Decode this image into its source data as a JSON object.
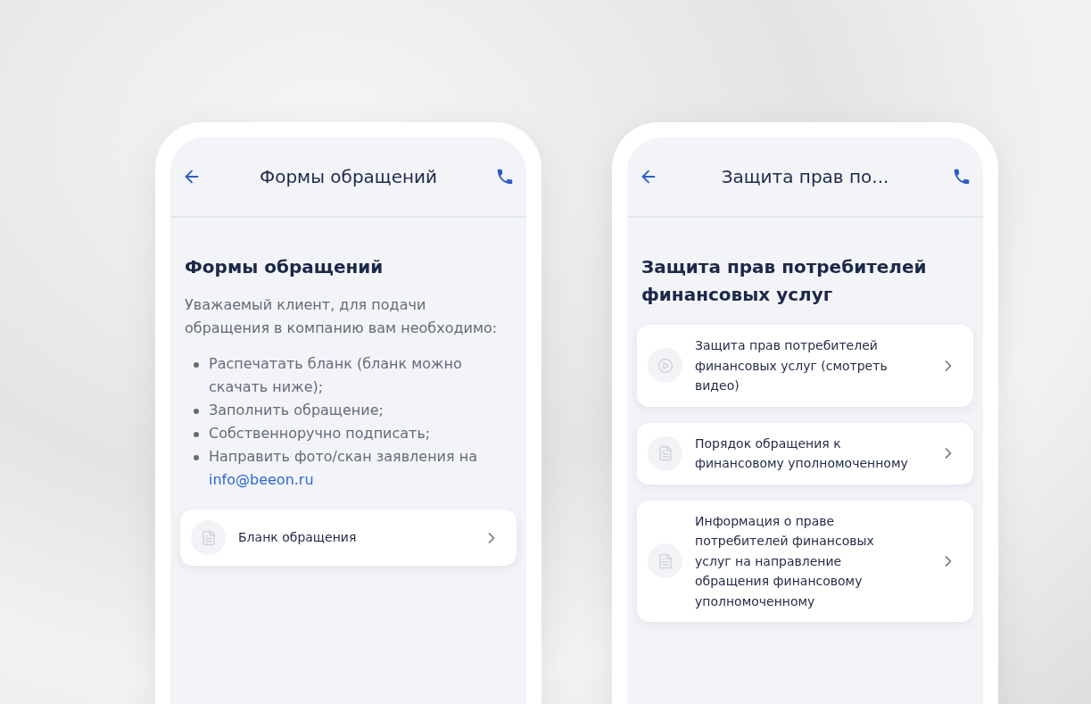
{
  "screens": [
    {
      "header": {
        "title": "Формы обращений"
      },
      "heading": "Формы обращений",
      "intro": "Уважаемый клиент, для подачи обращения в компанию вам необходимо:",
      "bullets": [
        {
          "text": "Распечатать бланк (бланк можно скачать ниже);"
        },
        {
          "text": "Заполнить обращение;"
        },
        {
          "text": "Собственноручно подписать;"
        },
        {
          "text": "Направить фото/скан заявления на",
          "link": "info@beeon.ru"
        }
      ],
      "items": [
        {
          "kind": "document",
          "label": "Бланк обращения"
        }
      ]
    },
    {
      "header": {
        "title": "Защита прав по..."
      },
      "heading": "Защита прав потребителей финансовых услуг",
      "items": [
        {
          "kind": "video",
          "label": "Защита прав потребителей финансовых услуг (смотреть видео)"
        },
        {
          "kind": "document",
          "label": "Порядок обращения к финансовому уполномоченному"
        },
        {
          "kind": "document",
          "label": "Информация о праве потребителей финансовых услуг на направление обращения финансовому уполномоченному"
        }
      ]
    }
  ]
}
